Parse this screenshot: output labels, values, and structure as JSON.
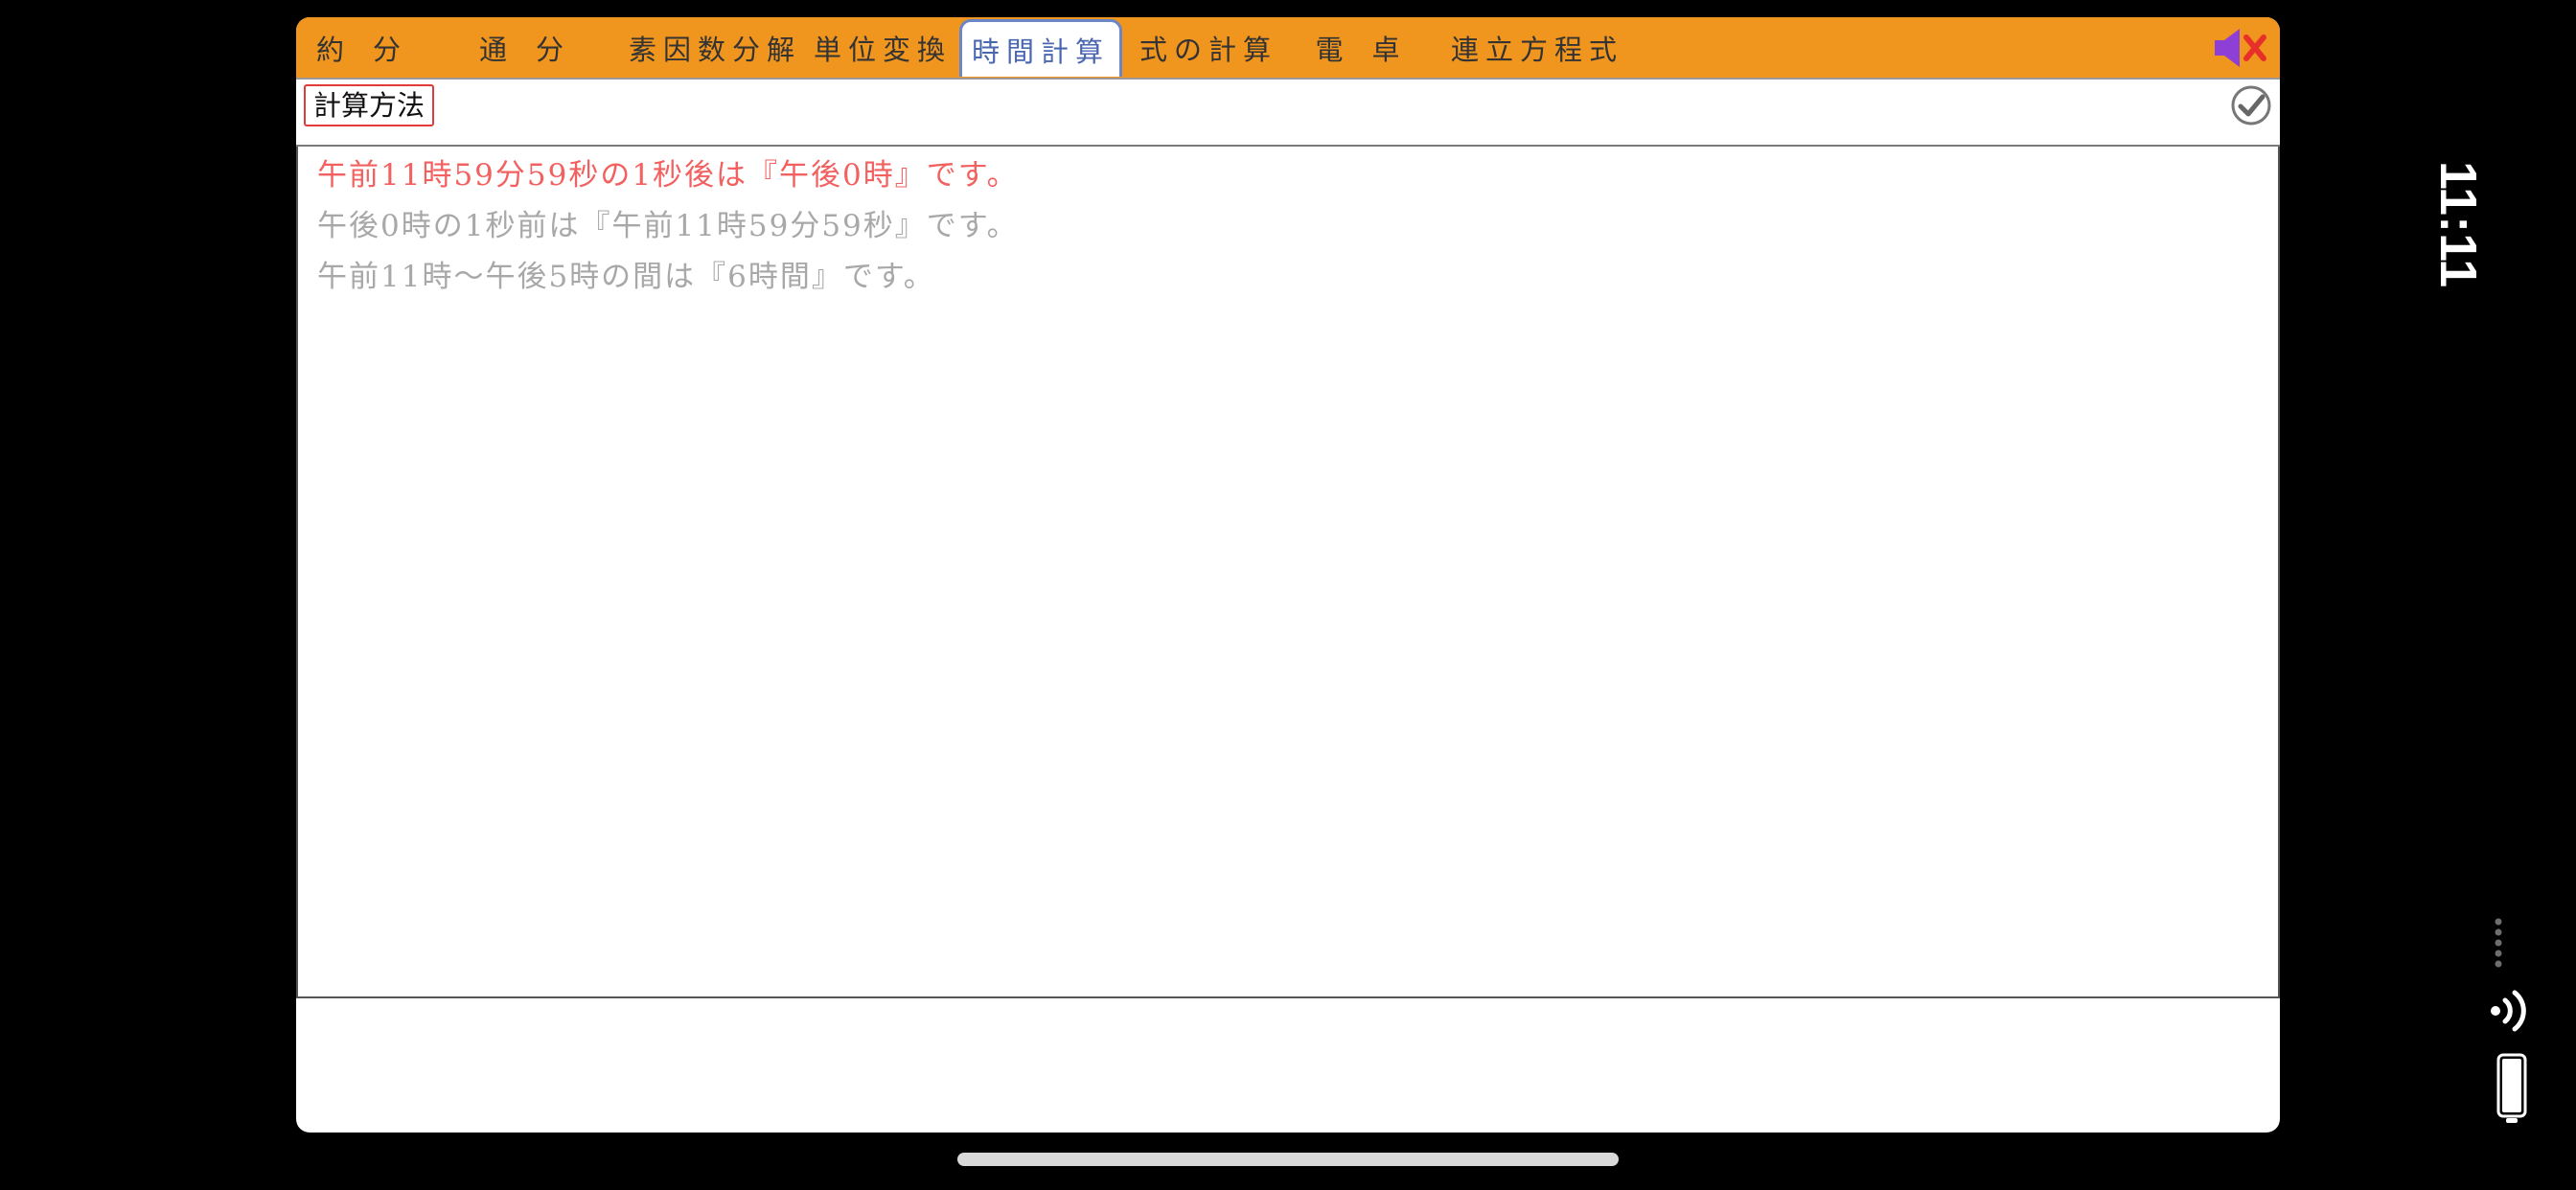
{
  "tabs": [
    {
      "label": "約分",
      "active": false
    },
    {
      "label": "通分",
      "active": false
    },
    {
      "label": "素因数分解",
      "active": false
    },
    {
      "label": "単位変換",
      "active": false
    },
    {
      "label": "時間計算",
      "active": true
    },
    {
      "label": "式の計算",
      "active": false
    },
    {
      "label": "電卓",
      "active": false
    },
    {
      "label": "連立方程式",
      "active": false
    }
  ],
  "toolbar": {
    "method_label": "計算方法"
  },
  "results": {
    "lines": [
      "午前11時59分59秒の1秒後は『午後0時』です。",
      "午後0時の1秒前は『午前11時59分59秒』です。",
      "午前11時〜午後5時の間は『6時間』です。"
    ]
  },
  "icons": {
    "mute": "speaker-muted-icon",
    "confirm": "check-circle-icon",
    "wifi": "wifi-icon",
    "battery": "battery-icon"
  },
  "status_bar": {
    "time": "11:11"
  },
  "colors": {
    "tab_bar": "#f0951d",
    "active_tab_border": "#6b86c6",
    "highlight_text": "#f26060",
    "muted_text": "#a8a8a8",
    "speaker": "#8e3fd6",
    "mute_x": "#e8302a"
  }
}
